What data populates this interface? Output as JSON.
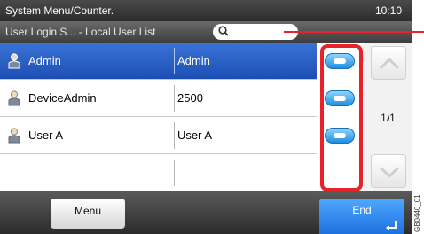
{
  "topbar": {
    "title": "System Menu/Counter.",
    "time": "10:10"
  },
  "subbar": {
    "breadcrumb": "User Login S... - Local User List",
    "search_value": ""
  },
  "icons": {
    "search": "search-icon",
    "trash": "trash-icon",
    "add": "plus-icon",
    "user": "user-icon",
    "details": "details-icon",
    "up": "scroll-up-icon",
    "down": "scroll-down-icon",
    "enter": "enter-icon"
  },
  "users": [
    {
      "name": "Admin",
      "login": "Admin",
      "selected": true
    },
    {
      "name": "DeviceAdmin",
      "login": "2500",
      "selected": false
    },
    {
      "name": "User A",
      "login": "User A",
      "selected": false
    },
    {
      "name": "",
      "login": "",
      "selected": false
    }
  ],
  "scroll": {
    "page_indicator": "1/1"
  },
  "bottom": {
    "menu_label": "Menu",
    "end_label": "End"
  },
  "side_code": "GB0440_01",
  "colors": {
    "highlight": "#e8212a",
    "selected_row": "#2a5fc4",
    "end_button": "#1e74e0"
  }
}
